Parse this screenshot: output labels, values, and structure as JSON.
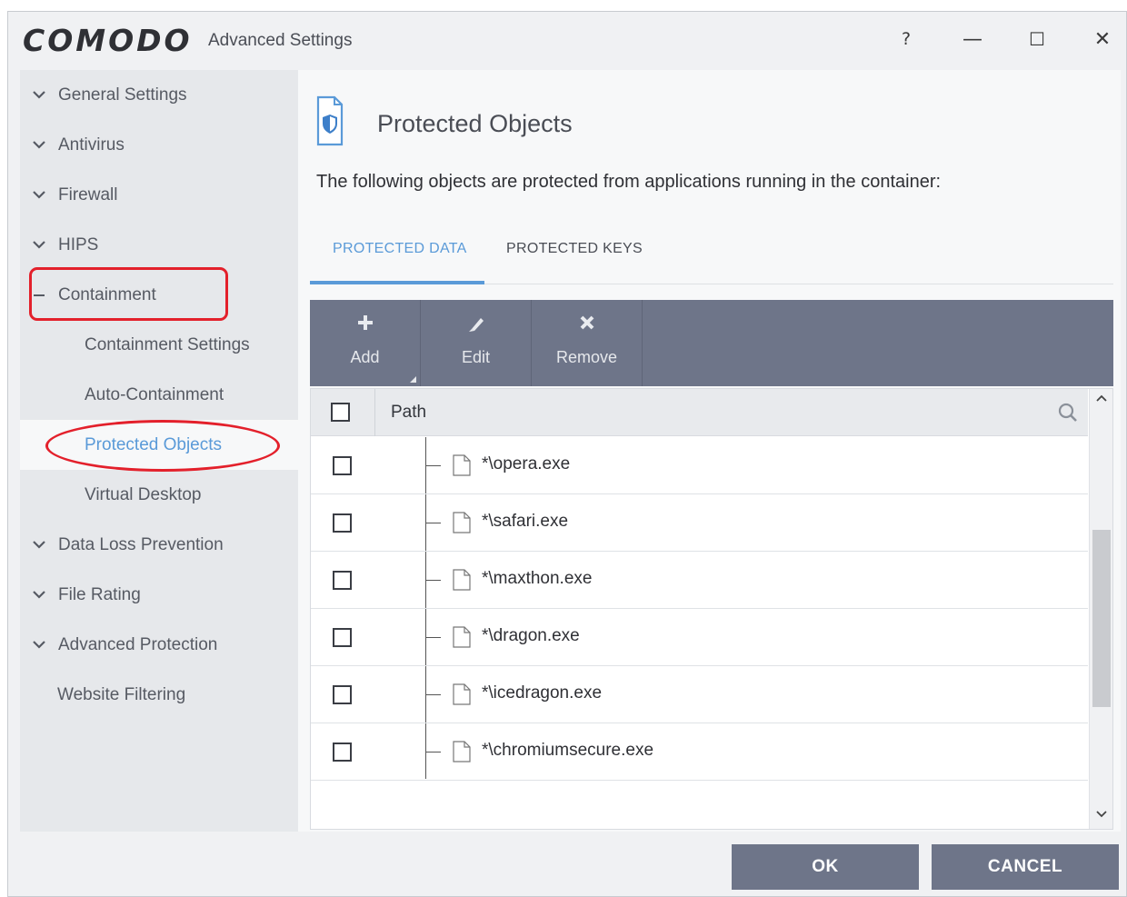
{
  "titlebar": {
    "logo": "COMODO",
    "app_title": "Advanced Settings",
    "help": "?",
    "minimize": "—",
    "maximize": "☐",
    "close": "✕"
  },
  "sidebar": {
    "items": [
      {
        "label": "General Settings",
        "expander": "collapsed"
      },
      {
        "label": "Antivirus",
        "expander": "collapsed"
      },
      {
        "label": "Firewall",
        "expander": "collapsed"
      },
      {
        "label": "HIPS",
        "expander": "collapsed"
      },
      {
        "label": "Containment",
        "expander": "expanded"
      },
      {
        "label": "Containment Settings"
      },
      {
        "label": "Auto-Containment"
      },
      {
        "label": "Protected Objects",
        "selected": true
      },
      {
        "label": "Virtual Desktop"
      },
      {
        "label": "Data Loss Prevention",
        "expander": "collapsed"
      },
      {
        "label": "File Rating",
        "expander": "collapsed"
      },
      {
        "label": "Advanced Protection",
        "expander": "collapsed"
      },
      {
        "label": "Website Filtering"
      }
    ]
  },
  "main": {
    "title": "Protected Objects",
    "description": "The following objects are protected from applications running in the container:",
    "tabs": [
      {
        "label": "PROTECTED DATA",
        "active": true
      },
      {
        "label": "PROTECTED KEYS",
        "active": false
      }
    ],
    "toolbar": {
      "add": "Add",
      "edit": "Edit",
      "remove": "Remove"
    },
    "table": {
      "column_path": "Path",
      "rows": [
        {
          "path": "*\\opera.exe"
        },
        {
          "path": "*\\safari.exe"
        },
        {
          "path": "*\\maxthon.exe"
        },
        {
          "path": "*\\dragon.exe"
        },
        {
          "path": "*\\icedragon.exe"
        },
        {
          "path": "*\\chromiumsecure.exe"
        }
      ]
    }
  },
  "footer": {
    "ok": "OK",
    "cancel": "CANCEL"
  },
  "colors": {
    "accent": "#5a9ad8",
    "toolbar": "#6e7589",
    "highlight_annotation": "#e3202b"
  }
}
